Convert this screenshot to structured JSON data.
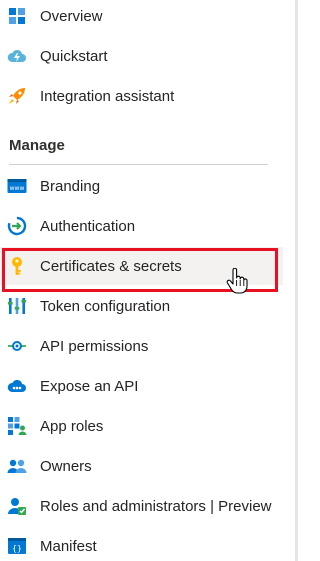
{
  "menu": {
    "items_top": [
      {
        "label": "Overview",
        "icon": "overview-grid-icon"
      },
      {
        "label": "Quickstart",
        "icon": "cloud-bolt-icon"
      },
      {
        "label": "Integration assistant",
        "icon": "rocket-icon"
      }
    ],
    "section_header": "Manage",
    "items_manage": [
      {
        "label": "Branding",
        "icon": "branding-www-icon"
      },
      {
        "label": "Authentication",
        "icon": "authentication-icon"
      },
      {
        "label": "Certificates & secrets",
        "icon": "key-icon",
        "selected": true
      },
      {
        "label": "Token configuration",
        "icon": "token-bars-icon"
      },
      {
        "label": "API permissions",
        "icon": "api-permissions-icon"
      },
      {
        "label": "Expose an API",
        "icon": "cloud-expose-icon"
      },
      {
        "label": "App roles",
        "icon": "app-roles-icon"
      },
      {
        "label": "Owners",
        "icon": "owners-icon"
      },
      {
        "label": "Roles and administrators | Preview",
        "icon": "roles-admin-icon"
      },
      {
        "label": "Manifest",
        "icon": "manifest-icon"
      }
    ]
  },
  "colors": {
    "highlight_border": "#e81123",
    "selected_bg": "#f3f2f1",
    "azure_blue": "#0078d4"
  }
}
